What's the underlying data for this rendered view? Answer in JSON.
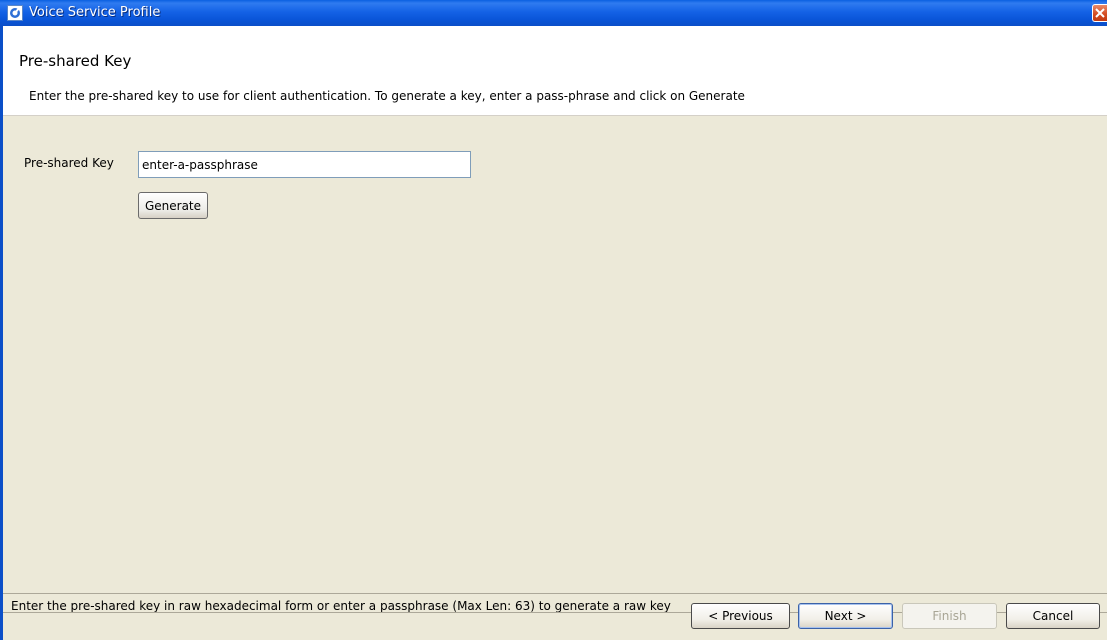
{
  "window": {
    "title": "Voice Service Profile",
    "icon": "app-icon",
    "close_icon": "close-icon"
  },
  "header": {
    "title": "Pre-shared Key",
    "description": "Enter the pre-shared key to use for client authentication. To generate a key, enter a pass-phrase and click on Generate"
  },
  "form": {
    "psk_label": "Pre-shared Key",
    "psk_value": "enter-a-passphrase",
    "generate_label": "Generate"
  },
  "status": {
    "text": "Enter the pre-shared key in raw hexadecimal form or enter a passphrase (Max Len: 63) to generate a raw key"
  },
  "buttons": {
    "previous": "< Previous",
    "next": "Next >",
    "finish": "Finish",
    "cancel": "Cancel"
  },
  "colors": {
    "titlebar": "#1462e6",
    "panel": "#ece9d8",
    "header_bg": "#ffffff"
  }
}
